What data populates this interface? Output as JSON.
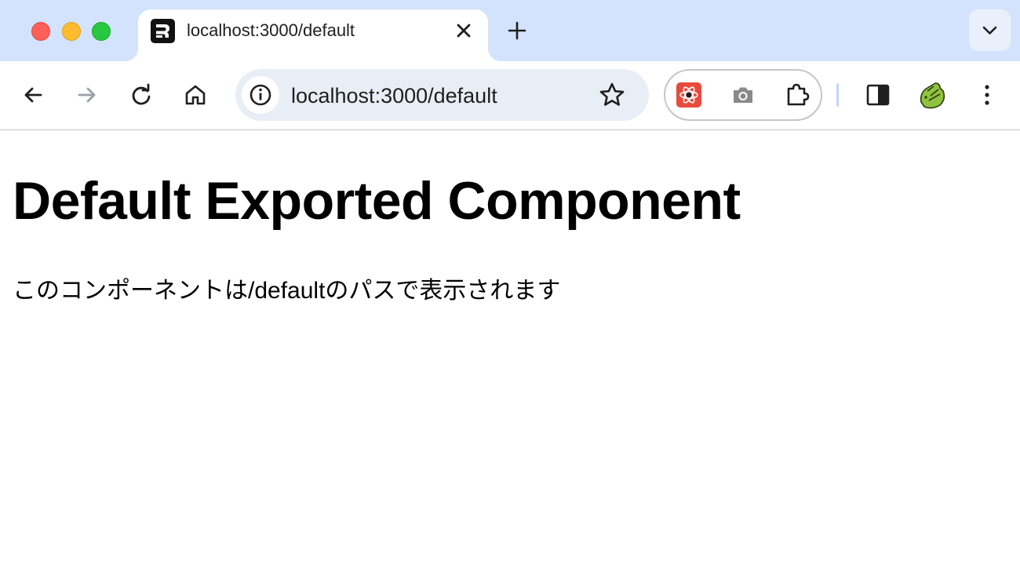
{
  "browser": {
    "tab": {
      "title": "localhost:3000/default",
      "favicon": "remix-logo-icon"
    },
    "toolbar": {
      "url": "localhost:3000/default",
      "extensions": [
        "react-devtools-icon",
        "camera-icon",
        "puzzle-icon"
      ]
    },
    "colors": {
      "tabstrip_bg": "#d3e3fd",
      "omnibox_bg": "#e9eef6"
    }
  },
  "page": {
    "heading": "Default Exported Component",
    "description": "このコンポーネントは/defaultのパスで表示されます"
  }
}
